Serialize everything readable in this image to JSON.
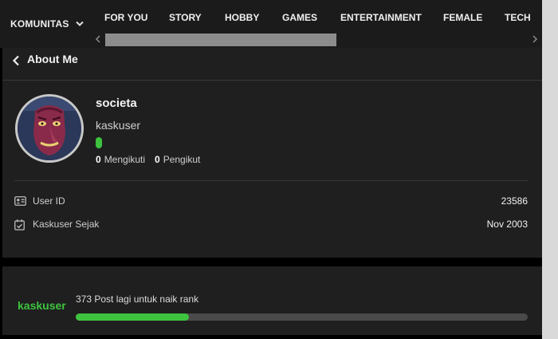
{
  "topbar": {
    "komunitas_label": "KOMUNITAS",
    "tabs": [
      {
        "label": "FOR YOU"
      },
      {
        "label": "STORY"
      },
      {
        "label": "HOBBY"
      },
      {
        "label": "GAMES"
      },
      {
        "label": "ENTERTAINMENT"
      },
      {
        "label": "FEMALE"
      },
      {
        "label": "TECH"
      }
    ]
  },
  "header": {
    "title": "About Me"
  },
  "profile": {
    "username": "societa",
    "user_title": "kaskuser",
    "following_count": "0",
    "following_label": "Mengikuti",
    "followers_count": "0",
    "followers_label": "Pengikut",
    "avatar_icon": "noh-mask-avatar"
  },
  "info": {
    "user_id_label": "User ID",
    "user_id_value": "23586",
    "user_id_icon": "id-card-icon",
    "since_label": "Kaskuser Sejak",
    "since_value": "Nov 2003",
    "since_icon": "calendar-check-icon"
  },
  "rank": {
    "brand": "kaskuser",
    "text": "373 Post lagi untuk naik rank",
    "progress_fraction": 0.25
  },
  "colors": {
    "accent_green": "#3ec33f",
    "card_bg": "#1f1f1f",
    "page_bg": "#000000"
  }
}
